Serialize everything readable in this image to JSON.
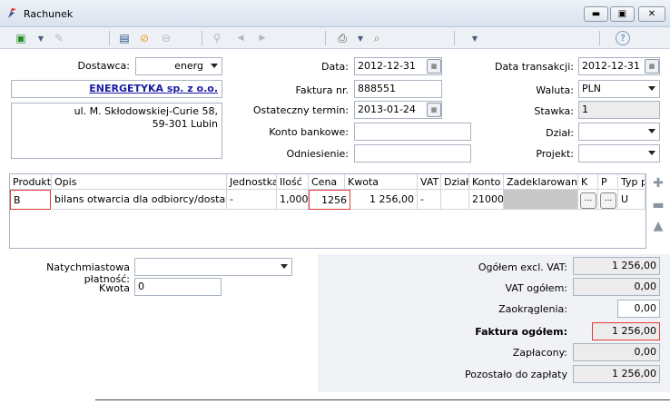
{
  "window": {
    "title": "Rachunek"
  },
  "form": {
    "dostawca_label": "Dostawca:",
    "dostawca_value": "energ",
    "company_name": "ENERGETYKA sp. z o.o.",
    "address_line1": "ul. M. Skłodowskiej-Curie 58,",
    "address_line2": "59-301  Lubin",
    "data_label": "Data:",
    "data_value": "2012-12-31",
    "faktura_label": "Faktura nr.",
    "faktura_value": "888551",
    "termin_label": "Ostateczny termin:",
    "termin_value": "2013-01-24",
    "konto_label": "Konto bankowe:",
    "konto_value": "",
    "odniesienie_label": "Odniesienie:",
    "odniesienie_value": "",
    "data_transakcji_label": "Data transakcji:",
    "data_transakcji_value": "2012-12-31",
    "waluta_label": "Waluta:",
    "waluta_value": "PLN",
    "stawka_label": "Stawka:",
    "stawka_value": "1",
    "dzial_label": "Dział:",
    "dzial_value": "",
    "projekt_label": "Projekt:",
    "projekt_value": ""
  },
  "grid": {
    "headers": [
      "Produkt",
      "Opis",
      "Jednostka",
      "Ilość",
      "Cena",
      "Kwota",
      "VAT",
      "Dział",
      "Konto",
      "Zadeklarowane",
      "K",
      "P",
      "Typ p"
    ],
    "row": {
      "produkt": "B",
      "opis": "bilans otwarcia dla odbiorcy/dostawcy",
      "jednostka": "-",
      "ilosc": "1,000",
      "cena": "1256",
      "kwota": "1 256,00",
      "vat": "-",
      "dzial": "",
      "konto": "21000",
      "zadeklarowane": "",
      "k": "...",
      "p": "...",
      "typ": "U"
    }
  },
  "bottom": {
    "natychmiastowa_label": "Natychmiastowa płatność:",
    "natychmiastowa_value": "",
    "kwota_label": "Kwota",
    "kwota_value": "0",
    "ogolem_excl_label": "Ogółem excl. VAT:",
    "ogolem_excl_value": "1 256,00",
    "vat_ogolem_label": "VAT ogółem:",
    "vat_ogolem_value": "0,00",
    "zaokraglenia_label": "Zaokrąglenia:",
    "zaokraglenia_value": "0,00",
    "faktura_ogolem_label": "Faktura ogółem:",
    "faktura_ogolem_value": "1 256,00",
    "zaplacony_label": "Zapłacony:",
    "zaplacony_value": "0,00",
    "pozostalo_label": "Pozostało do zapłaty",
    "pozostalo_value": "1 256,00"
  },
  "colors": {
    "highlight": "#e23a3a",
    "link": "#1a1aa6"
  }
}
